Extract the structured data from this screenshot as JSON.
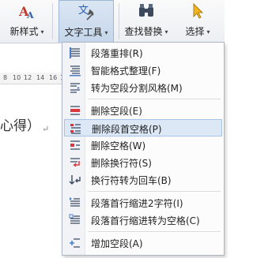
{
  "ribbon": {
    "style_label": "新样式",
    "texttools_label": "文字工具",
    "find_label": "查找替换",
    "select_label": "选择",
    "dropdown_arrow": "▾"
  },
  "ruler": {
    "ticks": [
      "8",
      "10",
      "12",
      "14",
      "16",
      "18"
    ]
  },
  "doc": {
    "text": "心得）",
    "return_mark": "↵"
  },
  "menu": {
    "items": [
      {
        "label": "段落重排(R)",
        "icon": "paragraph-rearrange-icon"
      },
      {
        "label": "智能格式整理(F)",
        "icon": "smart-format-icon"
      },
      {
        "label": "转为空段分割风格(M)",
        "icon": "convert-empty-paragraph-icon"
      },
      {
        "label": "删除空段(E)",
        "icon": "delete-empty-paragraph-icon"
      },
      {
        "label": "删除段首空格(P)",
        "icon": "delete-leading-space-icon",
        "highlighted": true
      },
      {
        "label": "删除空格(W)",
        "icon": "delete-space-icon"
      },
      {
        "label": "删除换行符(S)",
        "icon": "delete-line-break-icon"
      },
      {
        "label": "换行符转为回车(B)",
        "icon": "line-break-to-return-icon"
      },
      {
        "label": "段落首行缩进2字符(I)",
        "icon": "first-line-indent-icon"
      },
      {
        "label": "段落首行缩进转为空格(C)",
        "icon": "indent-to-space-icon"
      },
      {
        "label": "增加空段(A)",
        "icon": "add-empty-paragraph-icon"
      }
    ]
  },
  "colors": {
    "accent": "#4a7cc9",
    "highlight": "#dde8f6",
    "delete_red": "#d9363e"
  }
}
